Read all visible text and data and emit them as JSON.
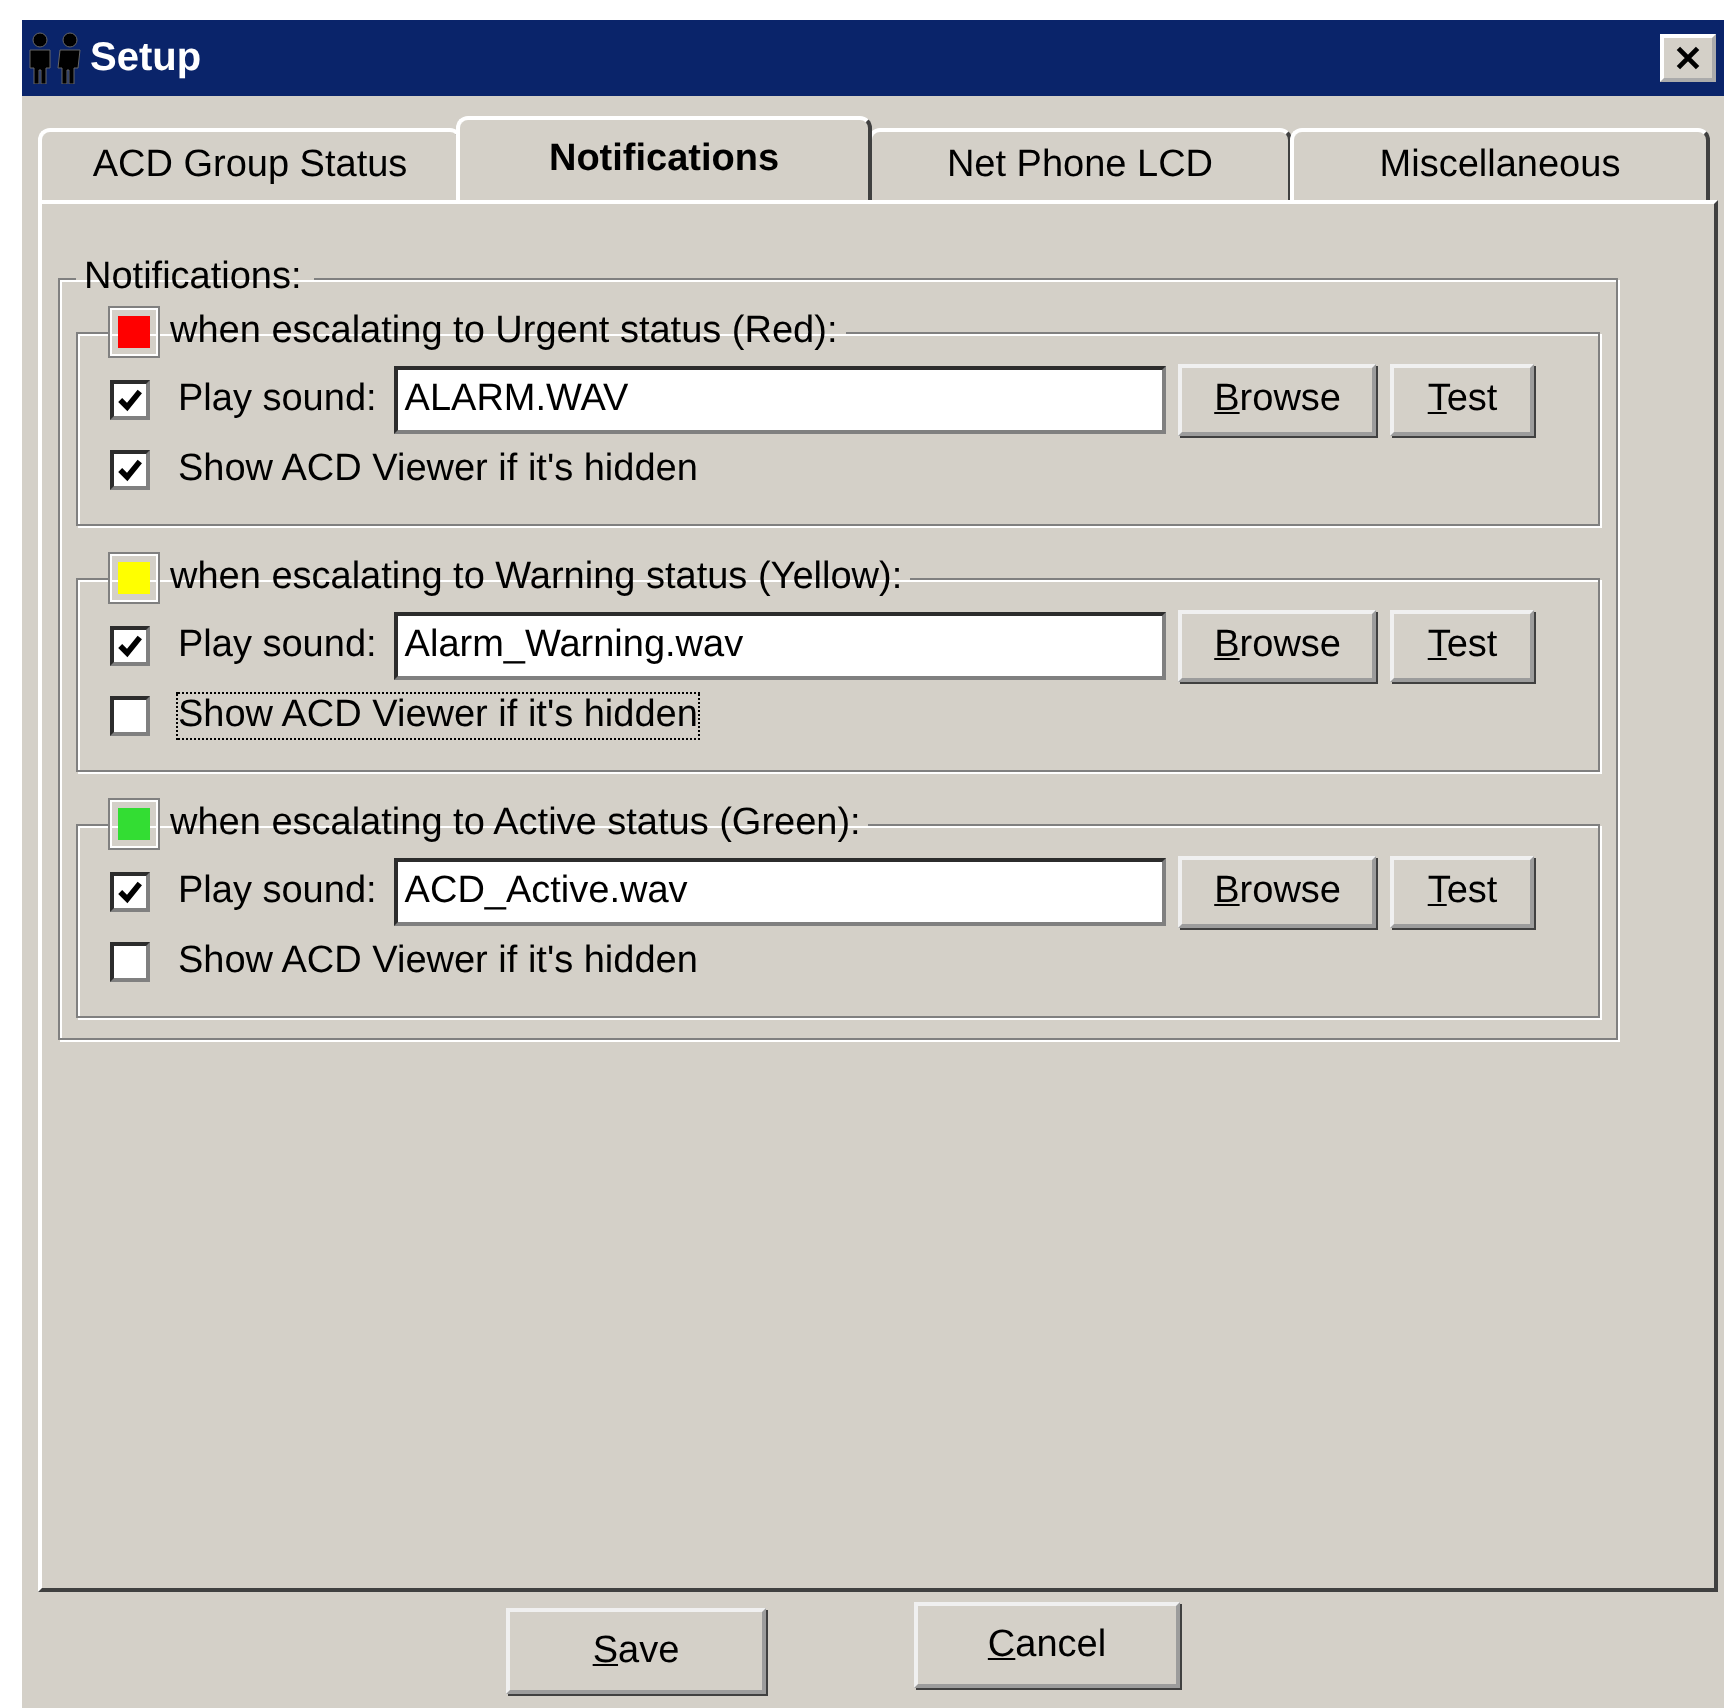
{
  "window": {
    "title": "Setup"
  },
  "tabs": [
    {
      "label": "ACD Group Status",
      "selected": false
    },
    {
      "label": "Notifications",
      "selected": true
    },
    {
      "label": "Net Phone LCD",
      "selected": false
    },
    {
      "label": "Miscellaneous",
      "selected": false
    }
  ],
  "notifications": {
    "label": "Notifications:",
    "sections": [
      {
        "label": "when escalating to Urgent status (Red):",
        "color": "#ff0000",
        "play_sound": {
          "checked": true,
          "label": "Play sound:",
          "value": "ALARM.WAV"
        },
        "show_viewer": {
          "checked": true,
          "focused": false,
          "label": "Show ACD Viewer if it's hidden"
        },
        "browse": {
          "key": "B",
          "rest": "rowse"
        },
        "test": {
          "key": "T",
          "rest": "est"
        }
      },
      {
        "label": "when escalating to Warning status (Yellow):",
        "color": "#ffff00",
        "play_sound": {
          "checked": true,
          "label": "Play sound:",
          "value": "Alarm_Warning.wav"
        },
        "show_viewer": {
          "checked": false,
          "focused": true,
          "label": "Show ACD Viewer if it's hidden"
        },
        "browse": {
          "key": "B",
          "rest": "rowse"
        },
        "test": {
          "key": "T",
          "rest": "est"
        }
      },
      {
        "label": "when escalating to Active status (Green):",
        "color": "#33dd33",
        "play_sound": {
          "checked": true,
          "label": "Play sound:",
          "value": "ACD_Active.wav"
        },
        "show_viewer": {
          "checked": false,
          "focused": false,
          "label": "Show ACD Viewer if it's hidden"
        },
        "browse": {
          "key": "B",
          "rest": "rowse"
        },
        "test": {
          "key": "T",
          "rest": "est"
        }
      }
    ]
  },
  "footer": {
    "save": {
      "key": "S",
      "rest": "ave"
    },
    "cancel": {
      "key": "C",
      "rest": "ancel"
    }
  }
}
